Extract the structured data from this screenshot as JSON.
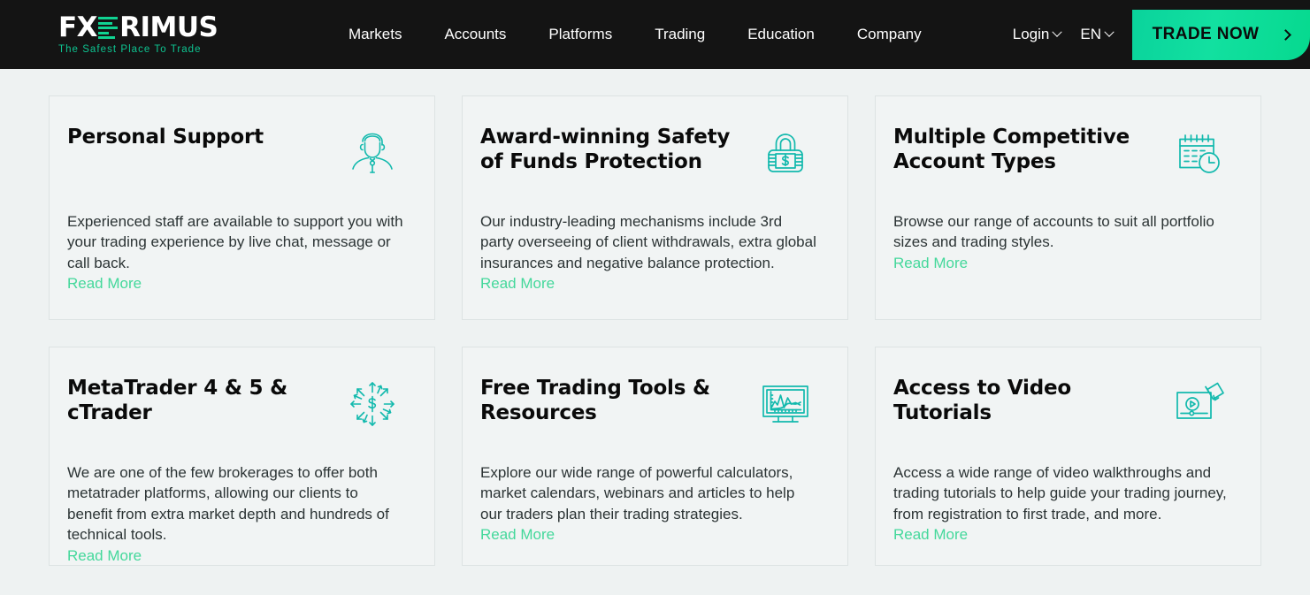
{
  "header": {
    "logo": {
      "part1": "FX",
      "part2": "RIMUS",
      "tagline": "The Safest Place To Trade",
      "bars_icon": "bar-chart-bars-icon"
    },
    "nav": [
      {
        "label": "Markets"
      },
      {
        "label": "Accounts"
      },
      {
        "label": "Platforms"
      },
      {
        "label": "Trading"
      },
      {
        "label": "Education"
      },
      {
        "label": "Company"
      }
    ],
    "login": {
      "label": "Login",
      "caret": "chevron-down-icon"
    },
    "language": {
      "label": "EN",
      "caret": "chevron-down-icon"
    },
    "cta": {
      "label": "TRADE NOW",
      "arrow": "chevron-right-icon"
    },
    "colors": {
      "bar_background": "#141414",
      "accent_green": "#10d392",
      "tagline_green": "#0ec491"
    }
  },
  "cards": [
    {
      "title": "Personal Support",
      "text": "Experienced staff are available to support you with your trading experience by live chat, message or call back.",
      "link": "Read More",
      "icon": "support-agent-person-icon"
    },
    {
      "title": "Award-winning Safety of Funds Protection",
      "text": "Our industry-leading mechanisms include 3rd party overseeing of client withdrawals, extra global insurances and negative balance protection.",
      "link": "Read More",
      "icon": "padlock-dollar-icon"
    },
    {
      "title": "Multiple Competitive Account Types",
      "text": "Browse our range of accounts to suit all portfolio sizes and trading styles.",
      "link": "Read More",
      "icon": "calendar-clock-icon"
    },
    {
      "title": "MetaTrader 4 & 5 & cTrader",
      "text": "We are one of the few brokerages to offer both metatrader platforms, allowing our clients to benefit from extra market depth and hundreds of technical tools.",
      "link": "Read More",
      "icon": "dollar-arrows-expand-icon"
    },
    {
      "title": "Free Trading Tools & Resources",
      "text": "Explore our wide range of powerful calculators, market calendars, webinars and articles to help our traders plan their trading strategies.",
      "link": "Read More",
      "icon": "monitor-line-chart-icon"
    },
    {
      "title": "Access to Video Tutorials",
      "text": "Access a wide range of video walkthroughs and trading tutorials to help guide your trading journey, from registration to first trade, and more.",
      "link": "Read More",
      "icon": "video-player-camera-icon"
    }
  ],
  "theme": {
    "page_background": "#eef2f2",
    "card_background": "#f1f4f4",
    "card_border": "#dde3e3",
    "icon_teal": "#12b9ad",
    "link_green": "#44d89b",
    "title_black": "#0a0a0a",
    "body_text": "#2b3334"
  }
}
